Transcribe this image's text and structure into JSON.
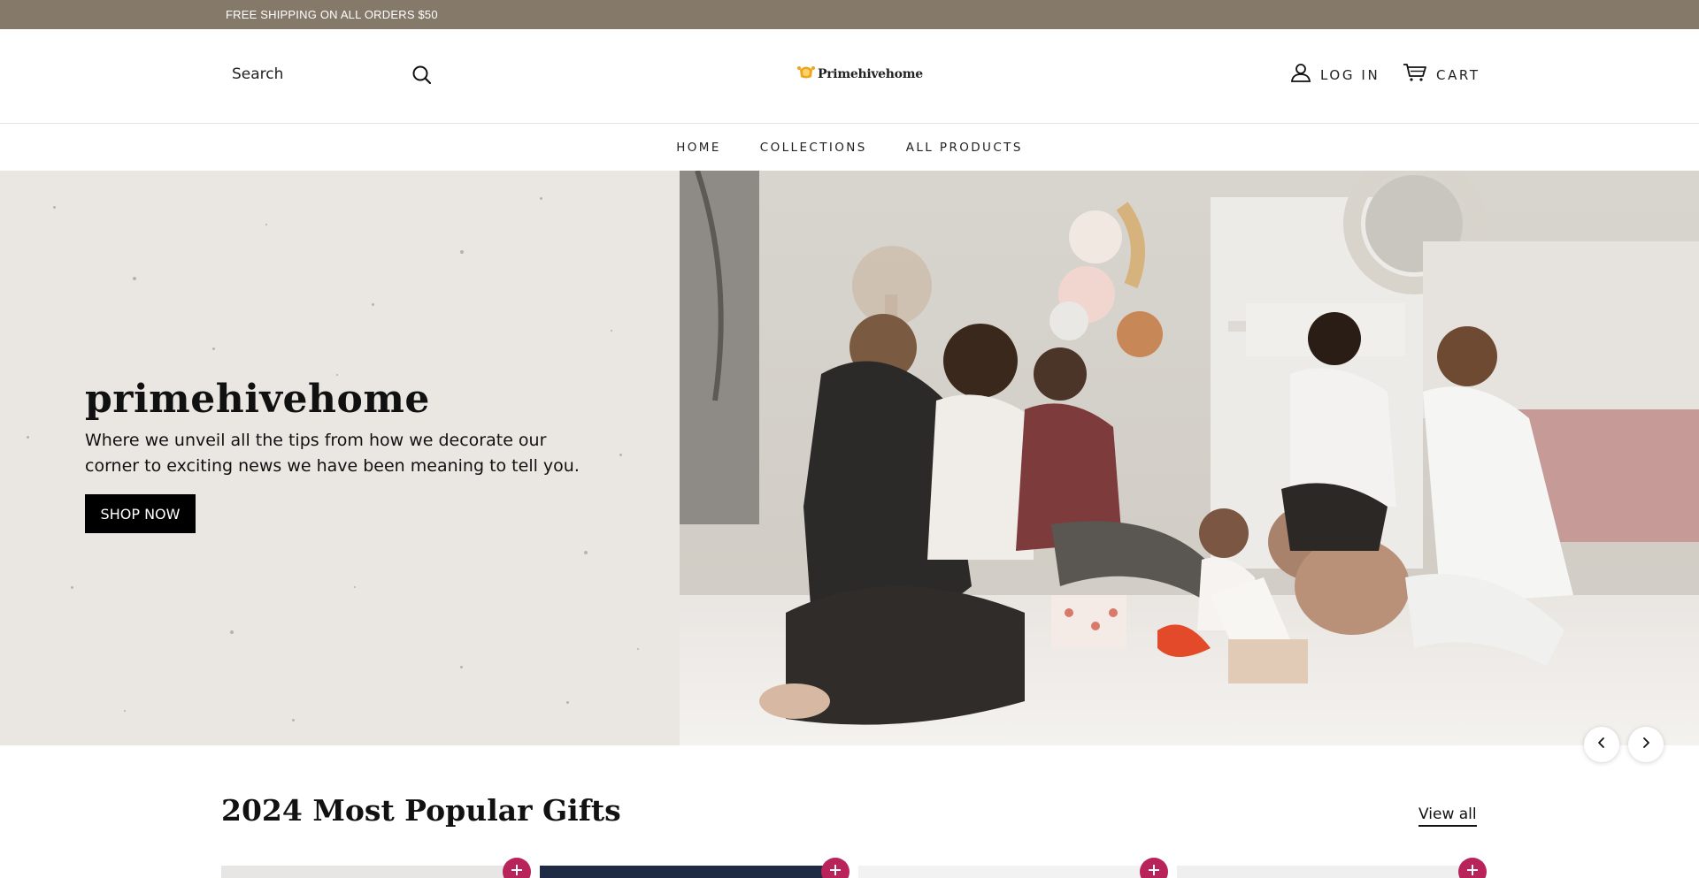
{
  "announcement": {
    "text": "FREE SHIPPING ON ALL ORDERS $50"
  },
  "header": {
    "search_placeholder": "Search",
    "logo_text": "Primehivehome",
    "login_label": "LOG IN",
    "cart_label": "CART"
  },
  "nav": {
    "items": [
      {
        "label": "HOME"
      },
      {
        "label": "COLLECTIONS"
      },
      {
        "label": "ALL PRODUCTS"
      }
    ]
  },
  "hero": {
    "title": "primehivehome",
    "subtitle": "Where we unveil all the tips from how we decorate our corner to exciting news we have been meaning to tell you.",
    "button_label": "SHOP NOW",
    "image_icon": "family-gift-photo",
    "prev_icon": "chevron-left-icon",
    "next_icon": "chevron-right-icon"
  },
  "products": {
    "title": "2024 Most Popular Gifts",
    "view_all_label": "View all",
    "add_icon": "plus-icon",
    "cards": [
      {
        "image_color": "#e7e6e4"
      },
      {
        "image_color": "#1f2a44"
      },
      {
        "image_color": "#f2f2f2"
      },
      {
        "image_color": "#efefef"
      }
    ]
  },
  "colors": {
    "announcement_bg": "#85796a",
    "hero_left_bg": "#eae7e2",
    "accent": "#b8235a",
    "button_bg": "#000000"
  }
}
